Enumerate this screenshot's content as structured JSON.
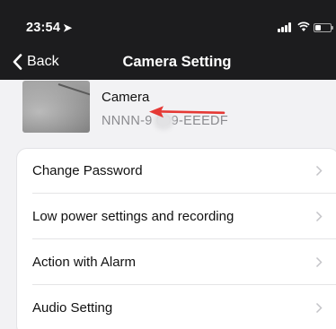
{
  "status_bar": {
    "time": "23:54",
    "location_glyph": "➤"
  },
  "nav": {
    "back_label": "Back",
    "title": "Camera Setting"
  },
  "device": {
    "name": "Camera",
    "id": "NNNN-9   099-EEEDF"
  },
  "menu": {
    "items": [
      {
        "label": "Change Password"
      },
      {
        "label": "Low power settings and recording"
      },
      {
        "label": "Action with Alarm"
      },
      {
        "label": "Audio Setting"
      }
    ]
  },
  "colors": {
    "header_bg": "#1c1c1e",
    "annotation_arrow": "#e53935"
  }
}
